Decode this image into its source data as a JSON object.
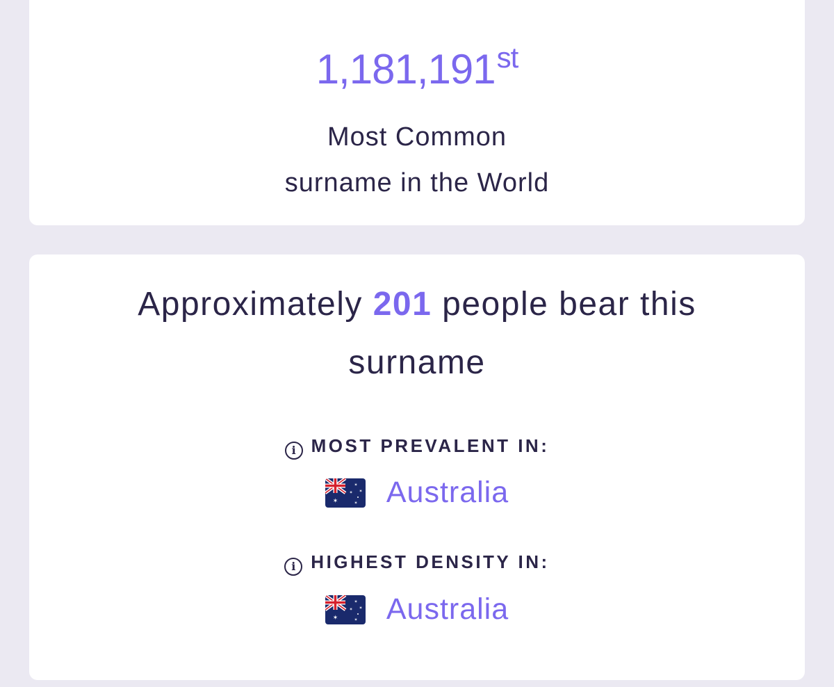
{
  "rank": {
    "number": "1,181,191",
    "suffix": "st",
    "line1": "Most Common",
    "line2": "surname in the World"
  },
  "bearers": {
    "prefix": "Approximately",
    "count": "201",
    "suffix": "people bear this surname"
  },
  "prevalent": {
    "heading": "MOST PREVALENT IN:",
    "country": "Australia",
    "flag_icon": "australia-flag-icon"
  },
  "density": {
    "heading": "HIGHEST DENSITY IN:",
    "country": "Australia",
    "flag_icon": "australia-flag-icon"
  },
  "colors": {
    "accent": "#7b68ee",
    "text": "#2b2548",
    "background": "#ebe9f2",
    "card": "#ffffff"
  }
}
